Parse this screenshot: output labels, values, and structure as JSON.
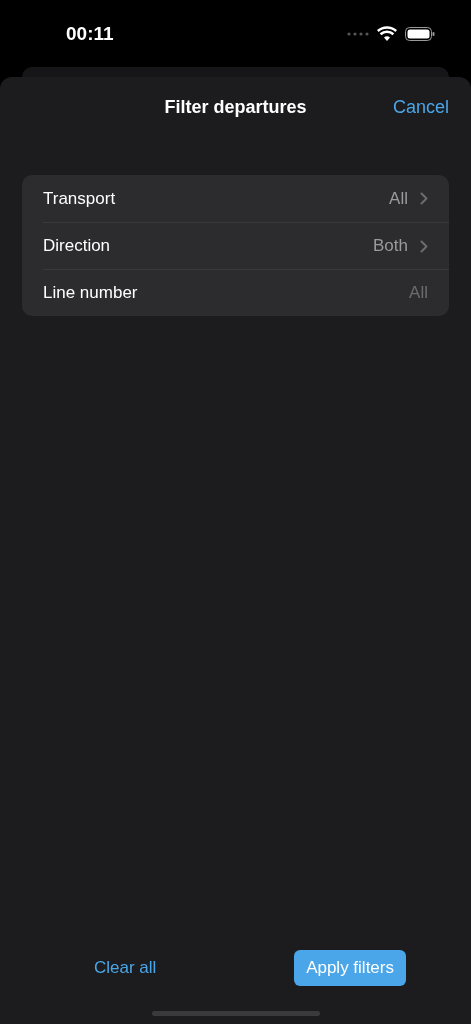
{
  "status_bar": {
    "time": "00:11"
  },
  "header": {
    "title": "Filter departures",
    "cancel": "Cancel"
  },
  "filters": [
    {
      "label": "Transport",
      "value": "All",
      "kind": "disclosure"
    },
    {
      "label": "Direction",
      "value": "Both",
      "kind": "disclosure"
    },
    {
      "label": "Line number",
      "value": "All",
      "kind": "field"
    }
  ],
  "footer": {
    "clear": "Clear all",
    "apply": "Apply filters"
  }
}
